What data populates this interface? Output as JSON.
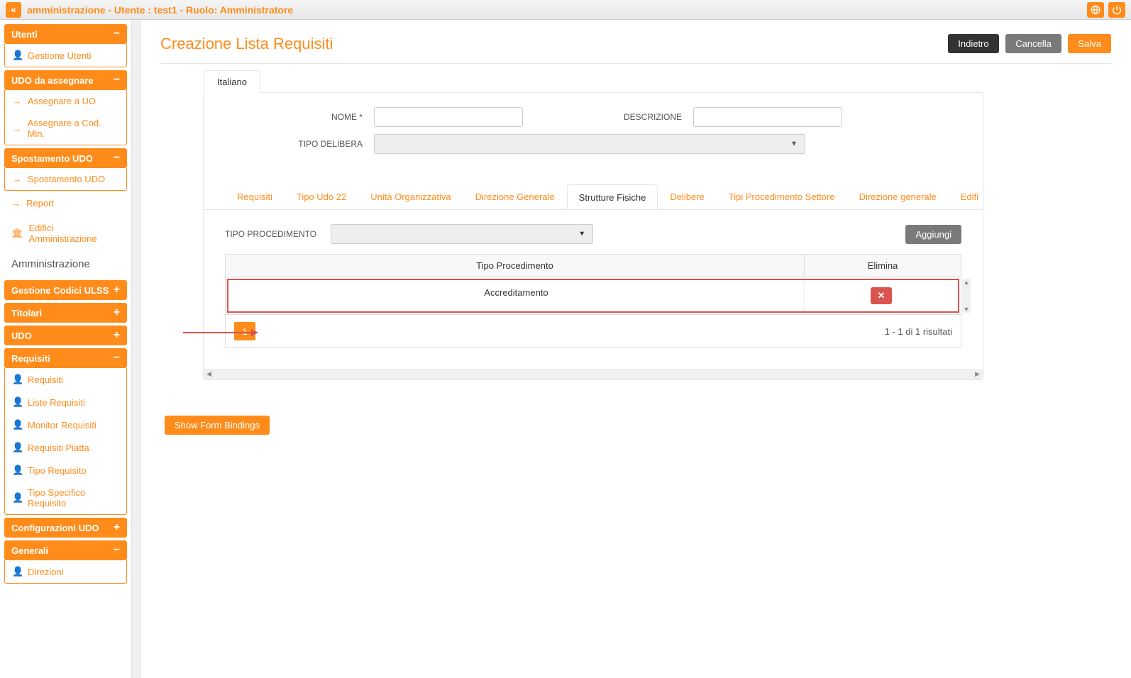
{
  "topbar": {
    "title": "amministrazione - Utente : test1 - Ruolo: Amministratore"
  },
  "sidebar": {
    "utenti": {
      "title": "Utenti",
      "items": [
        {
          "label": "Gestione Utenti"
        }
      ]
    },
    "udo_assegnare": {
      "title": "UDO da assegnare",
      "items": [
        {
          "label": "Assegnare a UO"
        },
        {
          "label": "Assegnare a Cod. Min."
        }
      ]
    },
    "spostamento": {
      "title": "Spostamento UDO",
      "items": [
        {
          "label": "Spostamento UDO"
        }
      ]
    },
    "plain": [
      {
        "label": "Report"
      },
      {
        "label": "Edifici Amministrazione"
      }
    ],
    "admin_label": "Amministrazione",
    "gestione_codici": {
      "title": "Gestione Codici ULSS"
    },
    "titolari": {
      "title": "Titolari"
    },
    "udo": {
      "title": "UDO"
    },
    "requisiti": {
      "title": "Requisiti",
      "items": [
        {
          "label": "Requisiti"
        },
        {
          "label": "Liste Requisiti"
        },
        {
          "label": "Monitor Requisiti"
        },
        {
          "label": "Requisiti Piatta"
        },
        {
          "label": "Tipo Requisito"
        },
        {
          "label": "Tipo Specifico Requisito"
        }
      ]
    },
    "configurazioni": {
      "title": "Configurazioni UDO"
    },
    "generali": {
      "title": "Generali",
      "items": [
        {
          "label": "Direzioni"
        }
      ]
    }
  },
  "page": {
    "title": "Creazione Lista Requisiti",
    "btn_back": "Indietro",
    "btn_cancel": "Cancella",
    "btn_save": "Salva"
  },
  "form": {
    "lang_tab": "Italiano",
    "nome_label": "NOME *",
    "descrizione_label": "DESCRIZIONE",
    "tipo_delibera_label": "TIPO DELIBERA"
  },
  "tabs": [
    {
      "label": "Requisiti"
    },
    {
      "label": "Tipo Udo 22"
    },
    {
      "label": "Unità Organizzativa"
    },
    {
      "label": "Direzione Generale"
    },
    {
      "label": "Strutture Fisiche",
      "active": true
    },
    {
      "label": "Delibere"
    },
    {
      "label": "Tipi Procedimento Settore"
    },
    {
      "label": "Direzione generale"
    },
    {
      "label": "Edifi"
    }
  ],
  "filter": {
    "label": "TIPO PROCEDIMENTO",
    "add_btn": "Aggiungi"
  },
  "table": {
    "headers": {
      "col1": "Tipo Procedimento",
      "col2": "Elimina"
    },
    "rows": [
      {
        "col1": "Accreditamento"
      }
    ],
    "page": "1",
    "results": "1 - 1 di 1 risultati"
  },
  "show_bindings": "Show Form Bindings"
}
